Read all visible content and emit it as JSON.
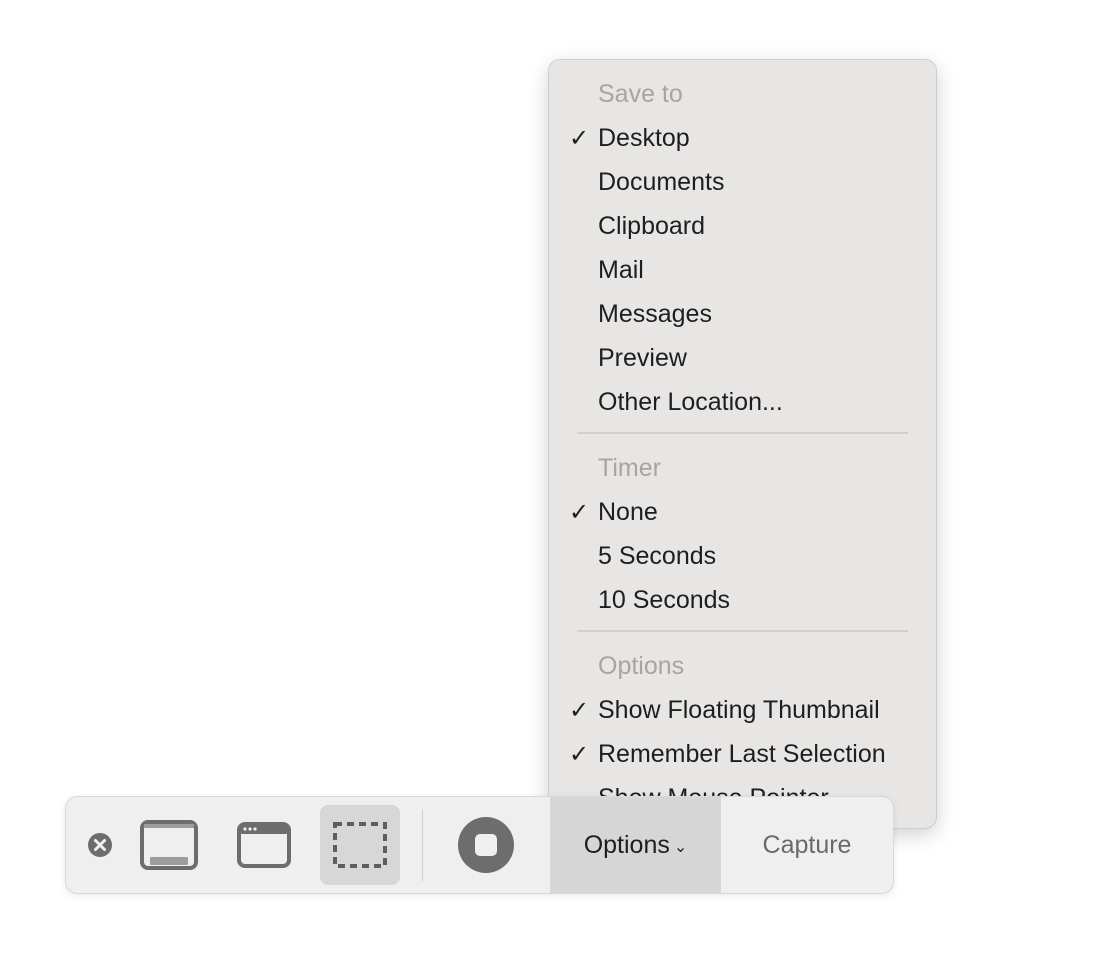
{
  "toolbar": {
    "icons": [
      "close-icon",
      "capture-entire-screen-icon",
      "capture-window-icon",
      "capture-selection-icon",
      "record-icon"
    ],
    "options_label": "Options",
    "options_chevron": "⌄",
    "capture_label": "Capture"
  },
  "menu": {
    "sections": [
      {
        "header": "Save to",
        "items": [
          {
            "label": "Desktop",
            "checked": true
          },
          {
            "label": "Documents",
            "checked": false
          },
          {
            "label": "Clipboard",
            "checked": false
          },
          {
            "label": "Mail",
            "checked": false
          },
          {
            "label": "Messages",
            "checked": false
          },
          {
            "label": "Preview",
            "checked": false
          },
          {
            "label": "Other Location...",
            "checked": false
          }
        ]
      },
      {
        "header": "Timer",
        "items": [
          {
            "label": "None",
            "checked": true
          },
          {
            "label": "5 Seconds",
            "checked": false
          },
          {
            "label": "10 Seconds",
            "checked": false
          }
        ]
      },
      {
        "header": "Options",
        "items": [
          {
            "label": "Show Floating Thumbnail",
            "checked": true
          },
          {
            "label": "Remember Last Selection",
            "checked": true
          },
          {
            "label": "Show Mouse Pointer",
            "checked": false
          }
        ]
      }
    ],
    "check_glyph": "✓"
  }
}
